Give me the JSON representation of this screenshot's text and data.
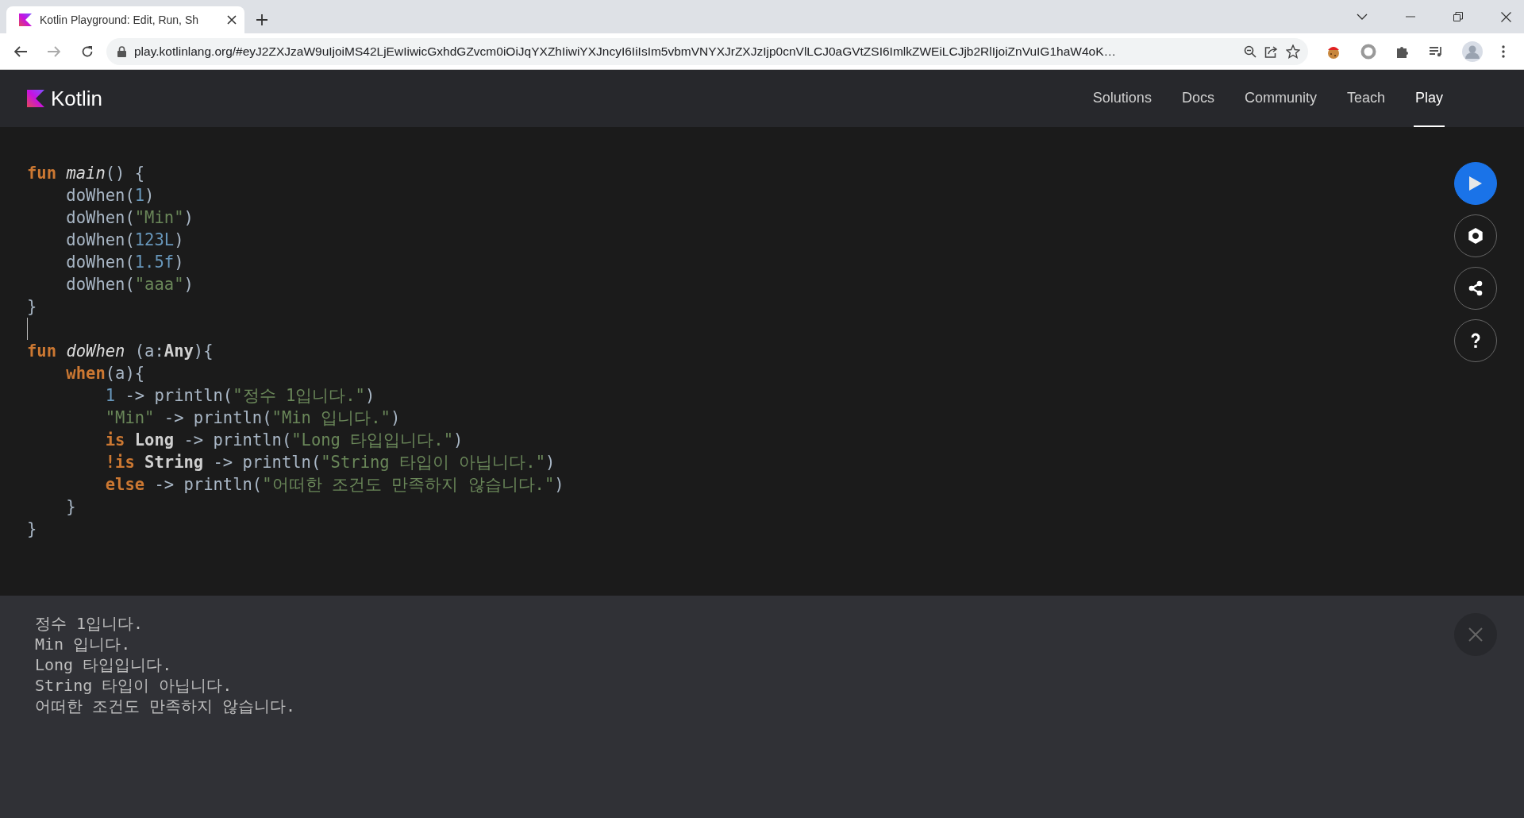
{
  "browser": {
    "tab": {
      "title": "Kotlin Playground: Edit, Run, Sh"
    },
    "url": "play.kotlinlang.org/#eyJ2ZXJzaW9uIjoiMS42LjEwIiwicGxhdGZvcm0iOiJqYXZhIiwiYXJncyI6IiIsIm5vbmVNYXJrZXJzIjp0cnVlLCJ0aGVtZSI6ImlkZWEiLCJjb2RlIjoiZnVuIG1haW4oK…"
  },
  "navbar": {
    "brand": "Kotlin",
    "links": [
      {
        "label": "Solutions",
        "selected": false
      },
      {
        "label": "Docs",
        "selected": false
      },
      {
        "label": "Community",
        "selected": false
      },
      {
        "label": "Teach",
        "selected": false
      },
      {
        "label": "Play",
        "selected": true
      }
    ]
  },
  "editor": {
    "lines": [
      {
        "cursor": false,
        "tokens": [
          {
            "text": "fun ",
            "kind": "kw"
          },
          {
            "text": "main",
            "kind": "fn"
          },
          {
            "text": "() {",
            "kind": "plain"
          }
        ]
      },
      {
        "cursor": false,
        "tokens": [
          {
            "text": "    doWhen(",
            "kind": "plain"
          },
          {
            "text": "1",
            "kind": "num"
          },
          {
            "text": ")",
            "kind": "plain"
          }
        ]
      },
      {
        "cursor": false,
        "tokens": [
          {
            "text": "    doWhen(",
            "kind": "plain"
          },
          {
            "text": "\"Min\"",
            "kind": "str"
          },
          {
            "text": ")",
            "kind": "plain"
          }
        ]
      },
      {
        "cursor": false,
        "tokens": [
          {
            "text": "    doWhen(",
            "kind": "plain"
          },
          {
            "text": "123L",
            "kind": "num"
          },
          {
            "text": ")",
            "kind": "plain"
          }
        ]
      },
      {
        "cursor": false,
        "tokens": [
          {
            "text": "    doWhen(",
            "kind": "plain"
          },
          {
            "text": "1.5f",
            "kind": "num"
          },
          {
            "text": ")",
            "kind": "plain"
          }
        ]
      },
      {
        "cursor": false,
        "tokens": [
          {
            "text": "    doWhen(",
            "kind": "plain"
          },
          {
            "text": "\"aaa\"",
            "kind": "str"
          },
          {
            "text": ")",
            "kind": "plain"
          }
        ]
      },
      {
        "cursor": false,
        "tokens": [
          {
            "text": "}",
            "kind": "plain"
          }
        ]
      },
      {
        "cursor": true
      },
      {
        "cursor": false,
        "tokens": [
          {
            "text": "fun ",
            "kind": "kw"
          },
          {
            "text": "doWhen",
            "kind": "fn"
          },
          {
            "text": " (a:",
            "kind": "plain"
          },
          {
            "text": "Any",
            "kind": "type"
          },
          {
            "text": "){",
            "kind": "plain"
          }
        ]
      },
      {
        "cursor": false,
        "tokens": [
          {
            "text": "    when",
            "kind": "kw"
          },
          {
            "text": "(a){",
            "kind": "plain"
          }
        ]
      },
      {
        "cursor": false,
        "tokens": [
          {
            "text": "        1",
            "kind": "num"
          },
          {
            "text": " -> println(",
            "kind": "plain"
          },
          {
            "text": "\"정수 1입니다.\"",
            "kind": "str"
          },
          {
            "text": ")",
            "kind": "plain"
          }
        ]
      },
      {
        "cursor": false,
        "tokens": [
          {
            "text": "        \"Min\"",
            "kind": "str"
          },
          {
            "text": " -> println(",
            "kind": "plain"
          },
          {
            "text": "\"Min 입니다.\"",
            "kind": "str"
          },
          {
            "text": ")",
            "kind": "plain"
          }
        ]
      },
      {
        "cursor": false,
        "tokens": [
          {
            "text": "        is ",
            "kind": "kw"
          },
          {
            "text": "Long",
            "kind": "type"
          },
          {
            "text": " -> println(",
            "kind": "plain"
          },
          {
            "text": "\"Long 타입입니다.\"",
            "kind": "str"
          },
          {
            "text": ")",
            "kind": "plain"
          }
        ]
      },
      {
        "cursor": false,
        "tokens": [
          {
            "text": "        !is ",
            "kind": "kw"
          },
          {
            "text": "String",
            "kind": "type"
          },
          {
            "text": " -> println(",
            "kind": "plain"
          },
          {
            "text": "\"String 타입이 아닙니다.\"",
            "kind": "str"
          },
          {
            "text": ")",
            "kind": "plain"
          }
        ]
      },
      {
        "cursor": false,
        "tokens": [
          {
            "text": "        else",
            "kind": "kw"
          },
          {
            "text": " -> println(",
            "kind": "plain"
          },
          {
            "text": "\"어떠한 조건도 만족하지 않습니다.\"",
            "kind": "str"
          },
          {
            "text": ")",
            "kind": "plain"
          }
        ]
      },
      {
        "cursor": false,
        "tokens": [
          {
            "text": "    }",
            "kind": "plain"
          }
        ]
      },
      {
        "cursor": false,
        "tokens": [
          {
            "text": "}",
            "kind": "plain"
          }
        ]
      }
    ]
  },
  "output": {
    "lines": [
      "정수 1입니다.",
      "Min 입니다.",
      "Long 타입입니다.",
      "String 타입이 아닙니다.",
      "어떠한 조건도 만족하지 않습니다."
    ]
  }
}
